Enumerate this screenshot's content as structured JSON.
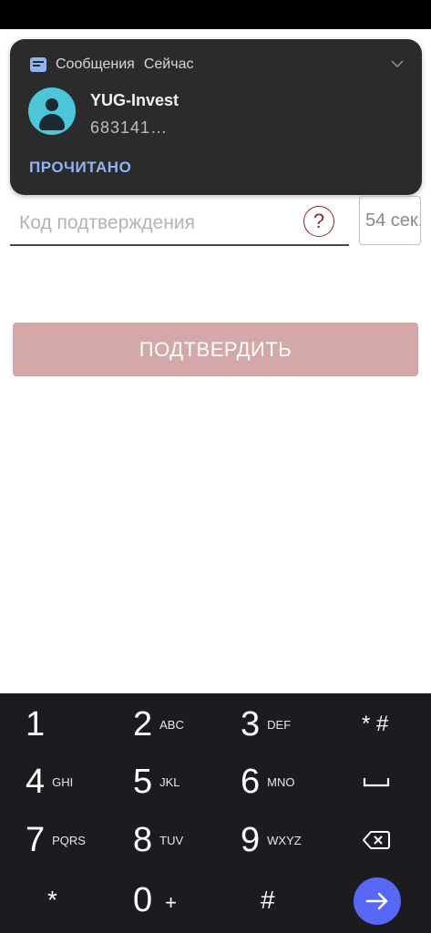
{
  "notification": {
    "app_name": "Сообщения",
    "time": "Сейчас",
    "title": "YUG-Invest",
    "text": "683141…",
    "action": "ПРОЧИТАНО"
  },
  "form": {
    "code_placeholder": "Код подтверждения",
    "help_symbol": "?",
    "timer": "54 сек.",
    "confirm_label": "ПОДТВЕРДИТЬ"
  },
  "keypad": {
    "keys": [
      {
        "digit": "1",
        "letters": ""
      },
      {
        "digit": "2",
        "letters": "ABC"
      },
      {
        "digit": "3",
        "letters": "DEF"
      },
      {
        "digit": "4",
        "letters": "GHI"
      },
      {
        "digit": "5",
        "letters": "JKL"
      },
      {
        "digit": "6",
        "letters": "MNO"
      },
      {
        "digit": "7",
        "letters": "PQRS"
      },
      {
        "digit": "8",
        "letters": "TUV"
      },
      {
        "digit": "9",
        "letters": "WXYZ"
      },
      {
        "digit": "*",
        "letters": ""
      },
      {
        "digit": "0",
        "letters": "+"
      },
      {
        "digit": "#",
        "letters": ""
      }
    ],
    "star_hash": "* #"
  },
  "colors": {
    "accent": "#5668f4",
    "confirm_button": "#d4a7a8",
    "help_icon": "#8b2a2a",
    "notification_action": "#8fb4f0"
  }
}
